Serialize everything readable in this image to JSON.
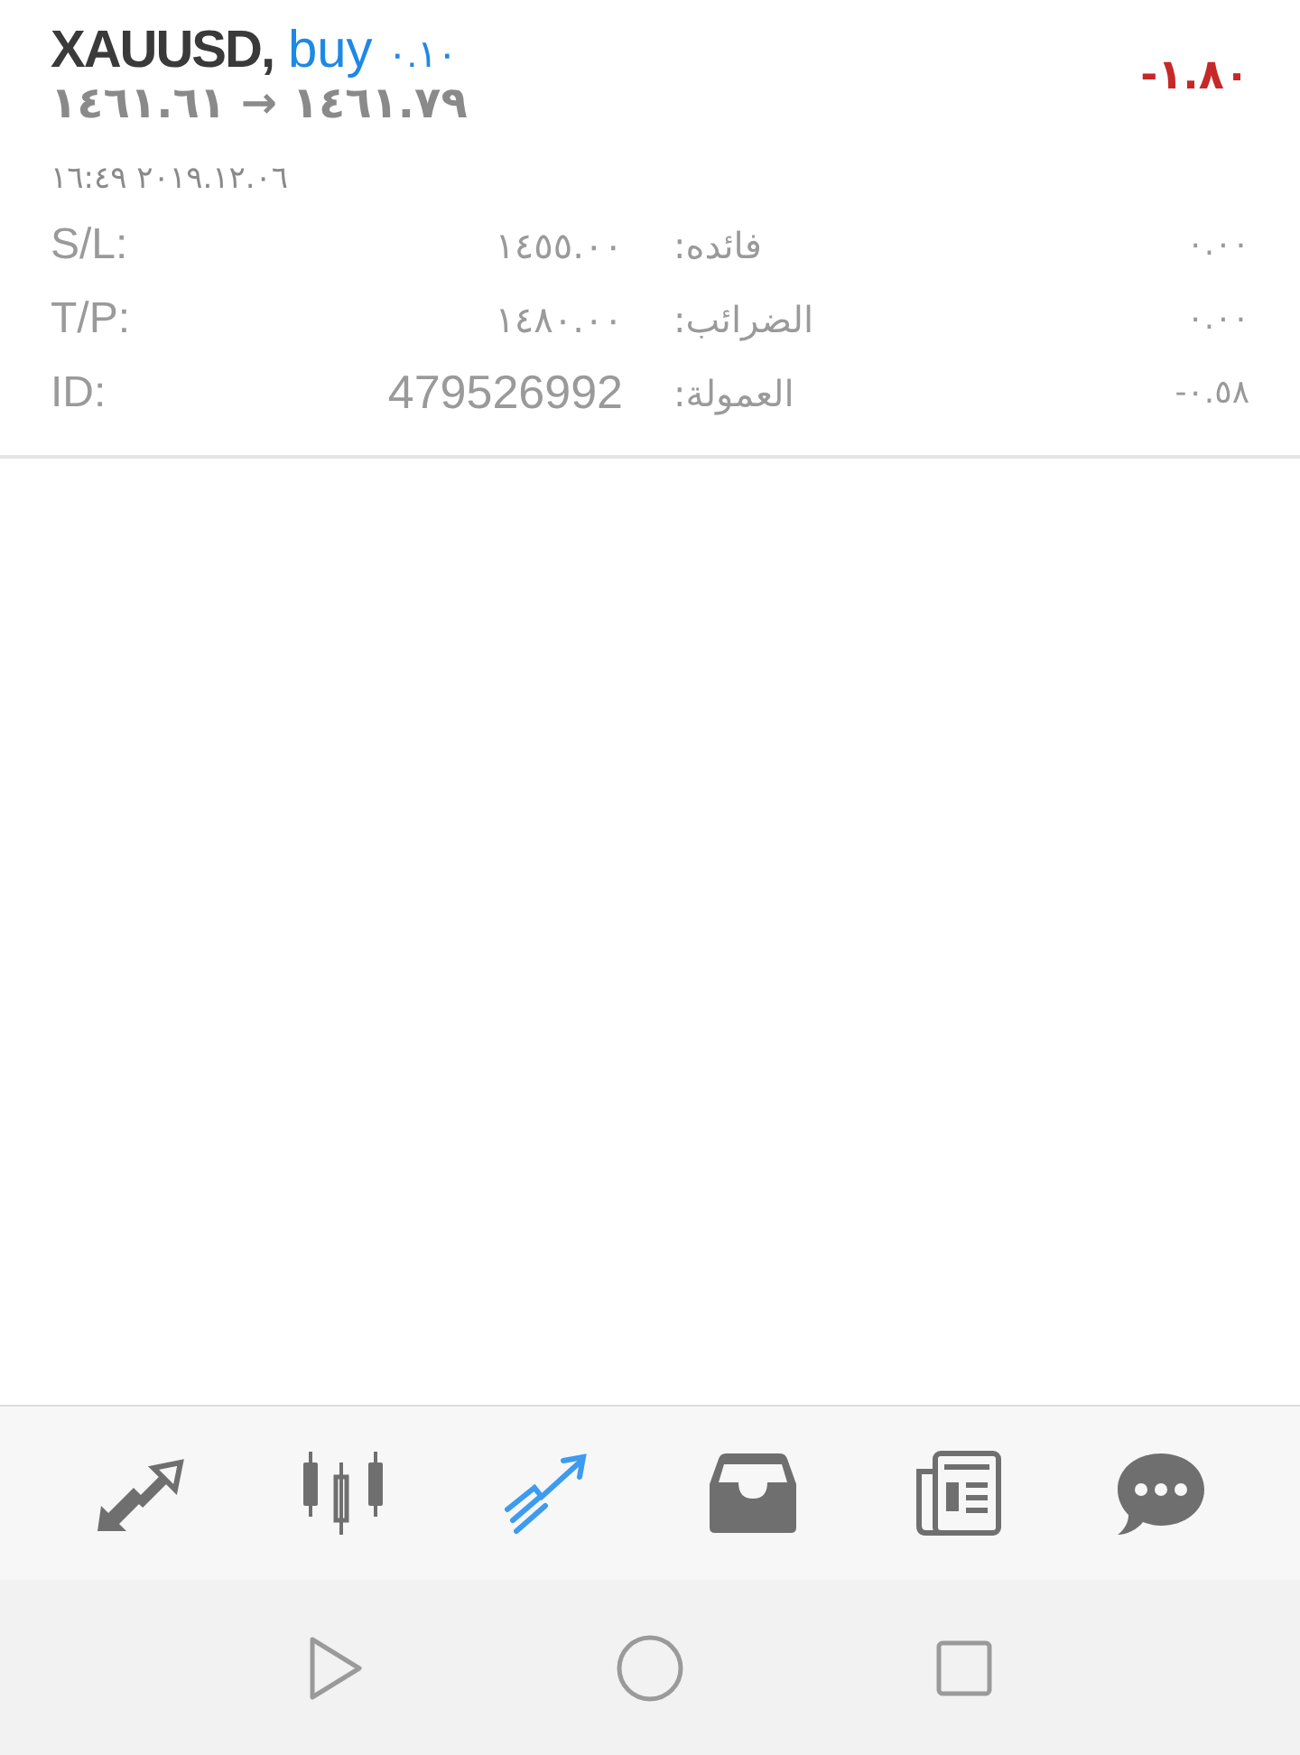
{
  "position": {
    "symbol": "XAUUSD,",
    "side": "buy",
    "volume": "٠.١٠",
    "prices": "١٤٦١.٦١ → ١٤٦١.٧٩",
    "profit": "-١.٨٠",
    "time": "٢٠١٩.١٢.٠٦ ١٦:٤٩"
  },
  "details": [
    {
      "label": "S/L:",
      "value": "١٤٥٥.٠٠",
      "label2": "فائده:",
      "value2": "٠.٠٠"
    },
    {
      "label": "T/P:",
      "value": "١٤٨٠.٠٠",
      "label2": "الضرائب:",
      "value2": "٠.٠٠"
    },
    {
      "label": "ID:",
      "value": "479526992",
      "label2": "العمولة:",
      "value2": "-٠.٥٨"
    }
  ],
  "tabs": [
    {
      "kind": "trade",
      "selected": false
    },
    {
      "kind": "chart",
      "selected": false
    },
    {
      "kind": "history",
      "selected": true
    },
    {
      "kind": "inbox",
      "selected": false
    },
    {
      "kind": "news",
      "selected": false
    },
    {
      "kind": "chat",
      "selected": false
    }
  ]
}
